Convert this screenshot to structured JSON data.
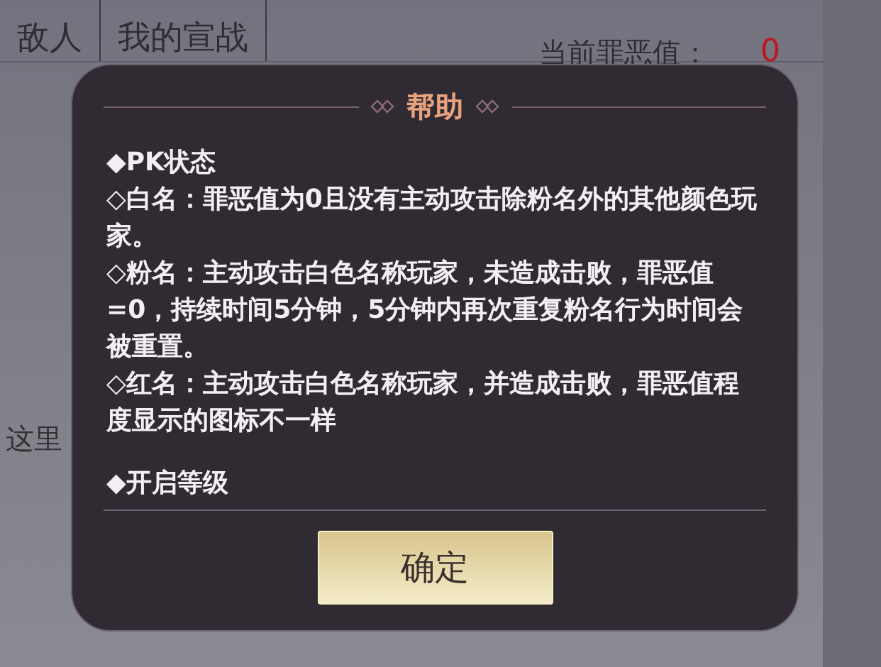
{
  "tabs": [
    {
      "label": "敌人",
      "selected": false
    },
    {
      "label": "我的宣战",
      "selected": false
    }
  ],
  "sin_value": {
    "label": "当前罪恶值：",
    "value": "0"
  },
  "background_text": "这里",
  "dialog": {
    "title": "帮助",
    "lines": [
      {
        "kind": "heading",
        "text": "◆PK状态"
      },
      {
        "kind": "item",
        "text": "◇白名：罪恶值为0且没有主动攻击除粉名外的其他颜色玩家。"
      },
      {
        "kind": "item",
        "text": "◇粉名：主动攻击白色名称玩家，未造成击败，罪恶值=0，持续时间5分钟，5分钟内再次重复粉名行为时间会被重置。"
      },
      {
        "kind": "item",
        "text": "◇红名：主动攻击白色名称玩家，并造成击败，罪恶值程度显示的图标不一样"
      },
      {
        "kind": "heading",
        "text": "◆开启等级"
      }
    ],
    "button": "确定"
  }
}
